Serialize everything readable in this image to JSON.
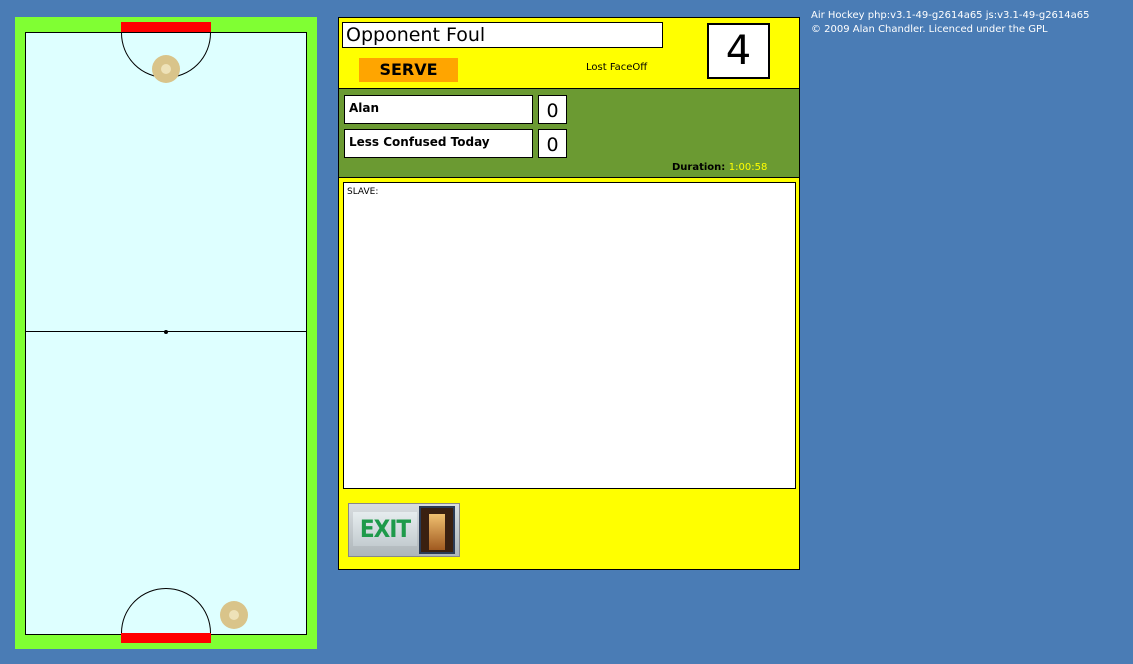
{
  "panel": {
    "message": "Opponent Foul",
    "serve_label": "SERVE",
    "status": "Lost FaceOff",
    "count": "4",
    "players": [
      {
        "name": "Alan",
        "score": "0"
      },
      {
        "name": "Less Confused Today",
        "score": "0"
      }
    ],
    "duration_label": "Duration:",
    "duration_value": "1:00:58",
    "log_text": "SLAVE:",
    "exit_label": "EXIT"
  },
  "credits": {
    "line1": "Air Hockey php:v3.1-49-g2614a65 js:v3.1-49-g2614a65",
    "line2": "© 2009 Alan Chandler. Licenced under the GPL"
  },
  "colors": {
    "background": "#4a7cb5",
    "rink_border": "#80ff33",
    "rink_surface": "#deffff",
    "goal": "#ff0000",
    "panel": "#ffff00",
    "players_bar": "#6b9a32",
    "serve_button": "#ffa500"
  }
}
